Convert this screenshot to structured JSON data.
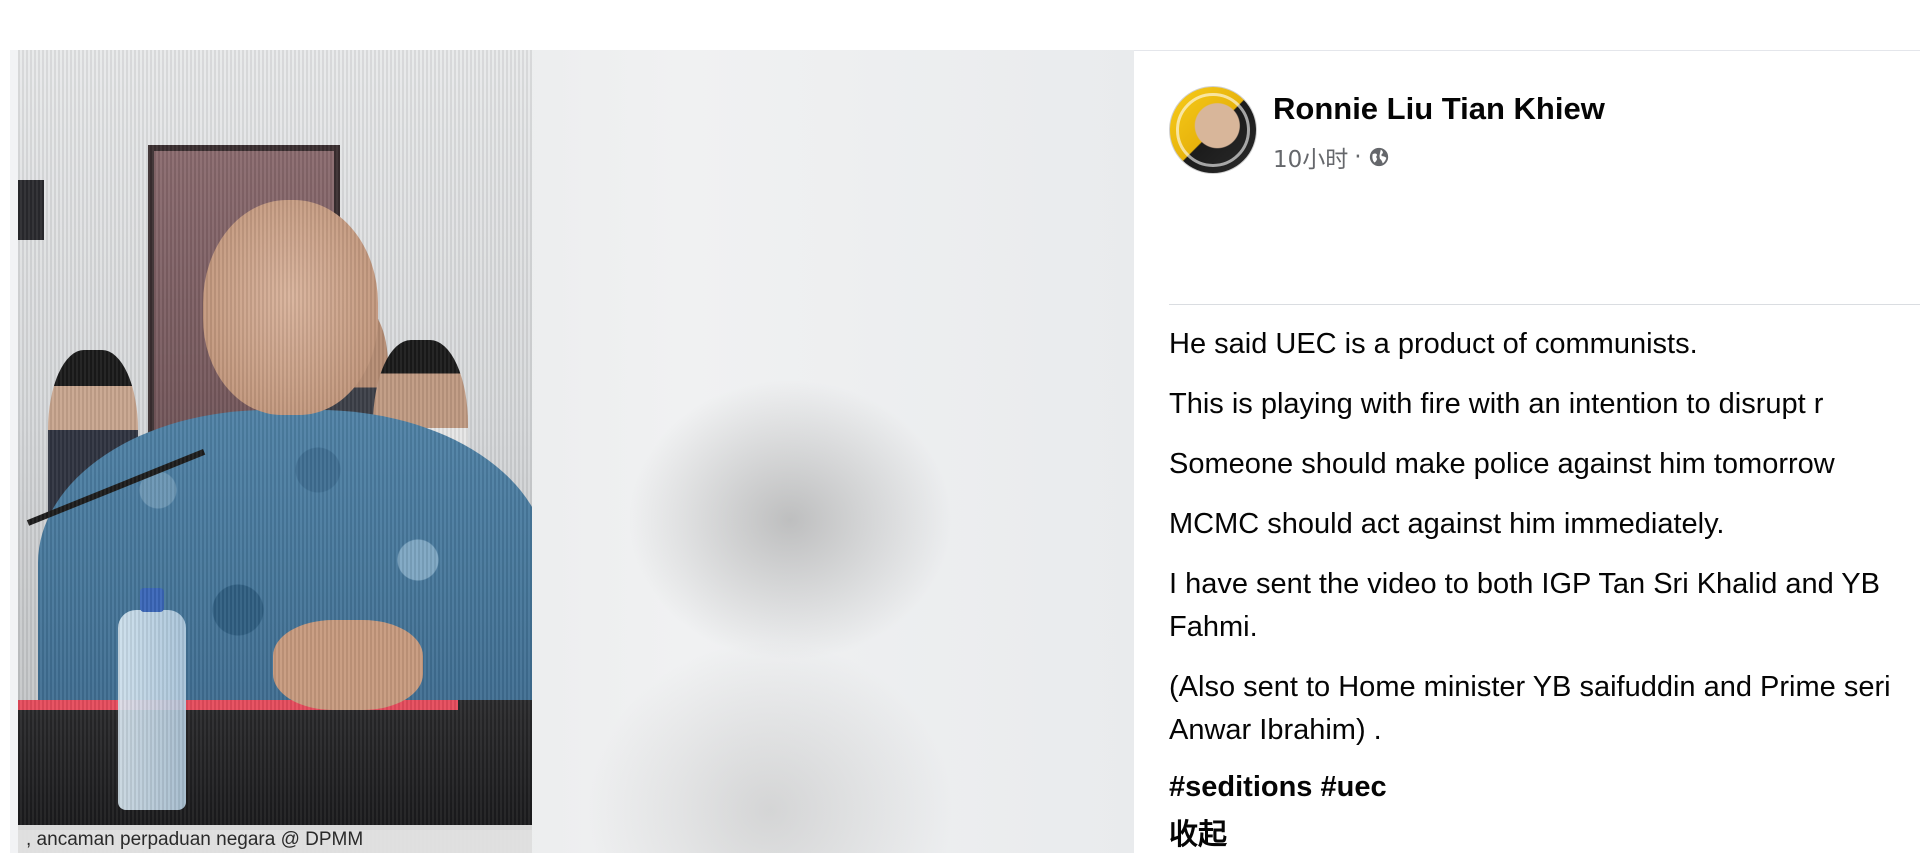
{
  "media": {
    "caption": ", ancaman perpaduan negara @ DPMM"
  },
  "post": {
    "author": "Ronnie Liu Tian Khiew",
    "time": "10小时",
    "separator": "·",
    "privacy_icon": "globe-icon",
    "paragraphs": [
      "He said UEC is a product of communists.",
      "This is playing with fire with an intention to disrupt r",
      "Someone should make police against him tomorrow",
      "MCMC should act against him immediately.",
      "I have sent the video to both IGP Tan Sri Khalid and YB Fahmi.",
      "(Also sent to Home minister YB saifuddin and Prime seri Anwar Ibrahim) ."
    ],
    "hashtags": "#seditions #uec",
    "see_less": "收起"
  },
  "colors": {
    "text_primary": "#050505",
    "text_secondary": "#65676b",
    "divider": "#dadde1"
  }
}
